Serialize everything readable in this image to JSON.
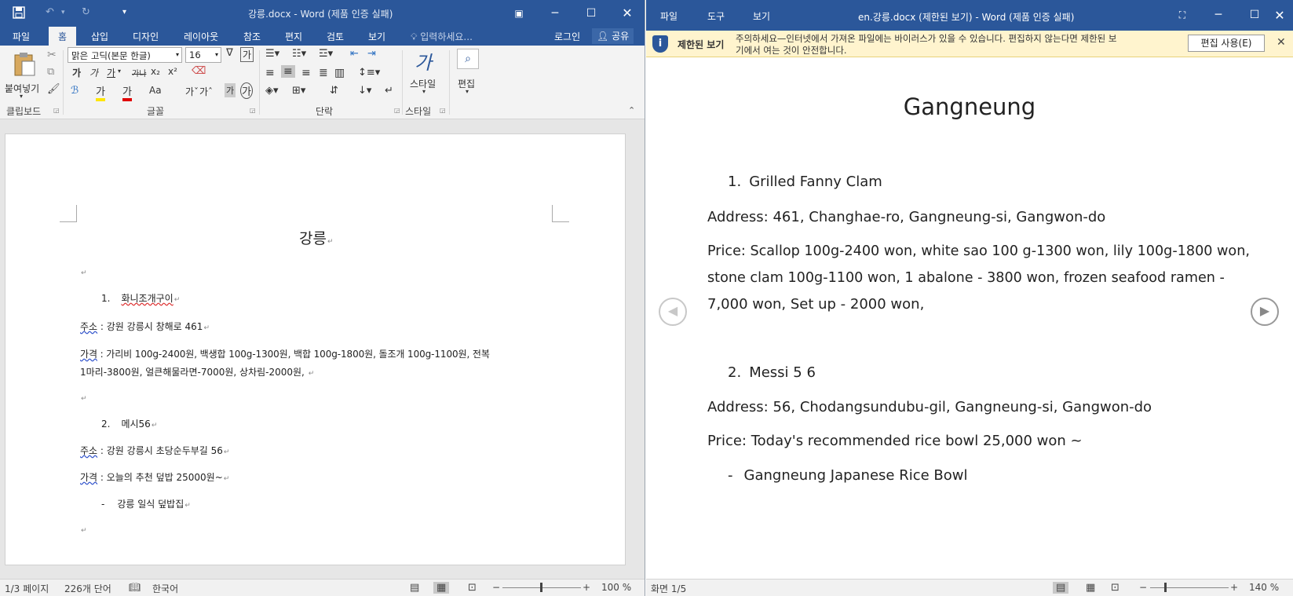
{
  "left": {
    "title": "강릉.docx - Word (제품 인증 실패)",
    "menu_tabs": [
      "파일",
      "홈",
      "삽입",
      "디자인",
      "레이아웃",
      "참조",
      "편지",
      "검토",
      "보기"
    ],
    "tell_me": "입력하세요...",
    "login": "로그인",
    "share": "공유",
    "ribbon": {
      "paste": "붙여넣기",
      "font_name": "맑은 고딕(본문 한글)",
      "font_size": "16",
      "style": "스타일",
      "edit": "편집",
      "groups": [
        "클립보드",
        "글꼴",
        "단락",
        "스타일"
      ]
    },
    "doc": {
      "title": "강릉",
      "item1": "1.",
      "item1_name": "화니조개구이",
      "addr1_label": "주소",
      "addr1": " : 강원 강릉시 창해로 461",
      "price1_label": "가격",
      "price1_a": " : 가리비 100g-2400원, 백생합 100g-1300원, 백합 100g-1800원, 돌조개 100g-1100원, 전복",
      "price1_b": "1마리-3800원, 얼큰해물라면-7000원, 상차림-2000원,",
      "item2": "2.",
      "item2_name": "메시56",
      "addr2_label": "주소",
      "addr2": " : 강원 강릉시 초당순두부길 56",
      "price2_label": "가격",
      "price2": " : 오늘의 추천 덮밥 25000원~",
      "bullet": "-",
      "bullet_text": "강릉 일식 덮밥집"
    },
    "status": {
      "page": "1/3 페이지",
      "words": "226개 단어",
      "lang": "한국어",
      "zoom": "100 %"
    }
  },
  "right": {
    "menu": [
      "파일",
      "도구",
      "보기"
    ],
    "title": "en.강릉.docx (제한된 보기) - Word (제품 인증 실패)",
    "info_label": "제한된 보기",
    "info_text_1": "주의하세요—인터넷에서 가져온 파일에는 바이러스가 있을 수 있습니다. 편집하지 않는다면 제한된 보",
    "info_text_2": "기에서 여는 것이 안전합니다.",
    "enable_edit": "편집 사용(E)",
    "doc": {
      "title": "Gangneung",
      "item1": "1.",
      "item1_name": "Grilled Fanny Clam",
      "addr1": "Address: 461, Changhae-ro, Gangneung-si, Gangwon-do",
      "price1_a": "Price: Scallop 100g-2400 won, white sao 100 g-1300 won, lily 100g-1800 won,",
      "price1_b": "stone clam 100g-1100 won, 1 abalone - 3800 won, frozen seafood ramen -",
      "price1_c": "7,000 won, Set up - 2000 won,",
      "item2": "2.",
      "item2_name": "Messi 5 6",
      "addr2": "Address: 56, Chodangsundubu-gil, Gangneung-si, Gangwon-do",
      "price2": "Price: Today's recommended rice bowl 25,000 won ~",
      "bullet": "-",
      "bullet_text": "Gangneung Japanese Rice Bowl"
    },
    "status": {
      "screen": "화면 1/5",
      "zoom": "140 %"
    }
  },
  "colors": {
    "word_blue": "#2b579a",
    "info_yellow": "#fff4ce"
  }
}
